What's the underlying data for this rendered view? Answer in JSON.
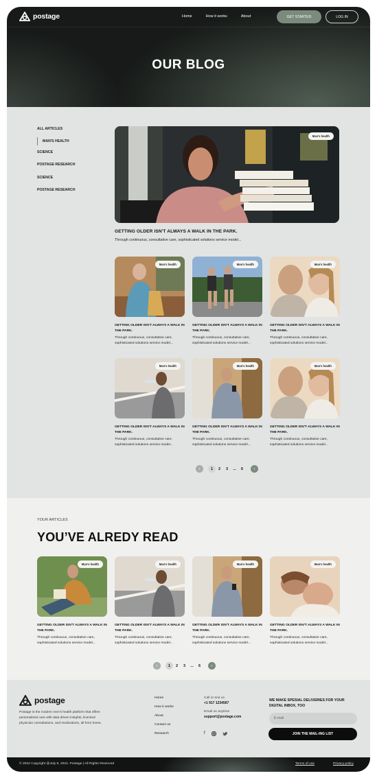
{
  "brand": {
    "name": "postage"
  },
  "nav": {
    "links": [
      "Home",
      "How it works",
      "About"
    ],
    "get_started": "GET STARTED",
    "login": "LOG IN"
  },
  "hero": {
    "title": "OUR BLOG"
  },
  "sidebar": {
    "items": [
      "ALL ARTICLES",
      "MAN'S HEALTH",
      "SCIENCE",
      "POSTAGE RESEARCH",
      "SCIENCE",
      "POSTAGE RESEARCH"
    ],
    "active_index": 1
  },
  "featured": {
    "tag": "Man's health",
    "title": "GETTING OLDER ISN'T ALWAYS A WALK IN THE PARK.",
    "subtitle": "Through continuous, consultative care, sophisticated solutions service model..."
  },
  "articles": [
    {
      "tag": "Man's health",
      "title": "GETTING OLDER ISN'T ALWAYS A WALK IN THE PARK.",
      "text": "Through continuous, consultative care, sophisticated solutions service model..."
    },
    {
      "tag": "Man's health",
      "title": "GETTING OLDER ISN'T ALWAYS A WALK IN THE PARK.",
      "text": "Through continuous, consultative care, sophisticated solutions service model..."
    },
    {
      "tag": "Man's health",
      "title": "GETTING OLDER ISN'T ALWAYS A WALK IN THE PARK.",
      "text": "Through continuous, consultative care, sophisticated solutions service model..."
    },
    {
      "tag": "Man's health",
      "title": "GETTING OLDER ISN'T ALWAYS A WALK IN THE PARK.",
      "text": "Through continuous, consultative care, sophisticated solutions service model..."
    },
    {
      "tag": "Man's health",
      "title": "GETTING OLDER ISN'T ALWAYS A WALK IN THE PARK.",
      "text": "Through continuous, consultative care, sophisticated solutions service model..."
    },
    {
      "tag": "Man's health",
      "title": "GETTING OLDER ISN'T ALWAYS A WALK IN THE PARK.",
      "text": "Through continuous, consultative care, sophisticated solutions service model..."
    }
  ],
  "pagination": {
    "pages": [
      "1",
      "2",
      "3",
      "...",
      "6"
    ],
    "current": "1"
  },
  "read_section": {
    "kicker": "YOUR ARTICLES",
    "title": "YOU’VE ALREDY READ",
    "articles": [
      {
        "tag": "Man's health",
        "title": "GETTING OLDER ISN'T ALWAYS A WALK IN THE PARK.",
        "text": "Through continuous, consultative care, sophisticated solutions service model..."
      },
      {
        "tag": "Man's health",
        "title": "GETTING OLDER ISN'T ALWAYS A WALK IN THE PARK.",
        "text": "Through continuous, consultative care, sophisticated solutions service model..."
      },
      {
        "tag": "Man's health",
        "title": "GETTING OLDER ISN'T ALWAYS A WALK IN THE PARK.",
        "text": "Through continuous, consultative care, sophisticated solutions service model..."
      },
      {
        "tag": "Man's health",
        "title": "GETTING OLDER ISN'T ALWAYS A WALK IN THE PARK.",
        "text": "Through continuous, consultative care, sophisticated solutions service model..."
      }
    ]
  },
  "footer": {
    "description": "Postage is the modern men's health platform that offers personalized care with data driven insights, licensed physician consultations, and medications, all from home.",
    "links": [
      "Home",
      "How it works",
      "About",
      "Contact us",
      "Research"
    ],
    "call_label": "Call or text us",
    "phone": "+1 917 1234567",
    "email_label": "Email us anytime",
    "email": "support@postage.com",
    "social": [
      "facebook-icon",
      "instagram-icon",
      "twitter-icon"
    ],
    "newsletter_title": "WE MAKE SPESIAL DELIVERIES FOR YOUR DIGITAL INBOX, TOO",
    "email_placeholder": "E-mail",
    "join_label": "JOIN THE MAIL-ING LIST",
    "copyright": "© 2022 Copyright @July 9, 2022. Postage  |  All Rights Reserved",
    "terms": "Terms of use",
    "privacy": "Privacy policy"
  },
  "colors": {
    "accent": "#7a8b7d",
    "dark": "#171a18",
    "page": "#e2e4e3"
  }
}
